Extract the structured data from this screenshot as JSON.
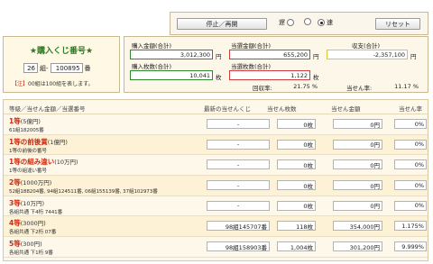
{
  "controls": {
    "stop_label": "停止／再開",
    "speed_slow": "遅",
    "speed_fast": "速",
    "reset_label": "リセット",
    "speed_selected": "fast"
  },
  "ticket": {
    "title": "★購入くじ番号★",
    "group": "26",
    "group_unit": "組-",
    "number": "100895",
    "number_unit": "番",
    "note_prefix": "【注】",
    "note_text": "00組は100組を表します。"
  },
  "summary": {
    "purchase_amount_label": "購入金額(合計)",
    "purchase_amount": "3,012,300",
    "purchase_amount_unit": "円",
    "purchase_count_label": "購入枚数(合計)",
    "purchase_count": "10,041",
    "purchase_count_unit": "枚",
    "win_amount_label": "当選金額(合計)",
    "win_amount": "655,200",
    "win_amount_unit": "円",
    "win_count_label": "当選枚数(合計)",
    "win_count": "1,122",
    "win_count_unit": "枚",
    "balance_label": "収支(合計)",
    "balance": "-2,357,100",
    "balance_unit": "円",
    "recovery_label": "回収率:",
    "recovery_value": "21.75 %",
    "win_rate_label": "当せん率:",
    "win_rate_value": "11.17 %"
  },
  "table": {
    "headers": [
      "等級／当せん金額／当選番号",
      "最新の当せんくじ",
      "当せん枚数",
      "当せん金額",
      "当せん率"
    ],
    "rows": [
      {
        "name": "1等",
        "prize": "(5億円)",
        "desc": "61組182005番",
        "latest": "-",
        "count": "0枚",
        "amount": "0円",
        "rate": "0%"
      },
      {
        "name": "1等の前後賞",
        "prize": "(1億円)",
        "desc": "1等の前後の番号",
        "latest": "-",
        "count": "0枚",
        "amount": "0円",
        "rate": "0%"
      },
      {
        "name": "1等の組み違い",
        "prize": "(10万円)",
        "desc": "1等の組違い番号",
        "latest": "-",
        "count": "0枚",
        "amount": "0円",
        "rate": "0%"
      },
      {
        "name": "2等",
        "prize": "(1000万円)",
        "desc": "52組188204番, 94組124511番, 06組155139番, 37組102973番",
        "latest": "-",
        "count": "0枚",
        "amount": "0円",
        "rate": "0%"
      },
      {
        "name": "3等",
        "prize": "(10万円)",
        "desc": "各組共通 下4桁 7441番",
        "latest": "-",
        "count": "0枚",
        "amount": "0円",
        "rate": "0%"
      },
      {
        "name": "4等",
        "prize": "(3000円)",
        "desc": "各組共通 下2桁 07番",
        "latest": "98組145707番",
        "count": "118枚",
        "amount": "354,000円",
        "rate": "1.175%"
      },
      {
        "name": "5等",
        "prize": "(300円)",
        "desc": "各組共通 下1桁 9番",
        "latest": "98組158903番",
        "count": "1,004枚",
        "amount": "301,200円",
        "rate": "9.999%"
      }
    ]
  },
  "colors": {
    "accent_green": "#2a7a1e",
    "prize_red": "#cc2a0f",
    "border_beige": "#c8b98e"
  }
}
